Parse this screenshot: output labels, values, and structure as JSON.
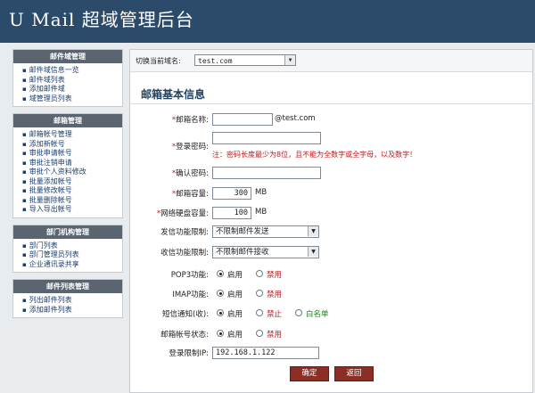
{
  "header": {
    "title": "U Mail 超域管理后台"
  },
  "sidebar": {
    "panels": [
      {
        "title": "邮件域管理",
        "items": [
          "邮件域信息一览",
          "邮件域列表",
          "添加邮件域",
          "域管理员列表"
        ]
      },
      {
        "title": "邮箱管理",
        "items": [
          "邮箱帐号管理",
          "添加新帐号",
          "审批申请帐号",
          "审批注销申请",
          "审批个人资料修改",
          "批量添加帐号",
          "批量修改帐号",
          "批量删除帐号",
          "导入导出帐号"
        ]
      },
      {
        "title": "部门机构管理",
        "items": [
          "部门列表",
          "部门管理员列表",
          "企业通讯录共享"
        ]
      },
      {
        "title": "邮件列表管理",
        "items": [
          "列出邮件列表",
          "添加邮件列表"
        ]
      }
    ]
  },
  "topbar": {
    "label": "切换当前域名:",
    "domain": "test.com"
  },
  "form": {
    "title": "邮箱基本信息",
    "mailbox_name": {
      "label": "邮箱名称:",
      "value": "",
      "suffix": "@test.com"
    },
    "password": {
      "label": "登录密码:",
      "value": "",
      "hint": "注：密码长度最少为8位，且不能为全数字或全字母，以及数字！"
    },
    "confirm": {
      "label": "确认密码:",
      "value": ""
    },
    "mail_capacity": {
      "label": "邮箱容量:",
      "value": "300",
      "unit": "MB"
    },
    "disk_capacity": {
      "label": "网络硬盘容量:",
      "value": "100",
      "unit": "MB"
    },
    "send_limit": {
      "label": "发信功能限制:",
      "value": "不限制邮件发送"
    },
    "recv_limit": {
      "label": "收信功能限制:",
      "value": "不限制邮件接收"
    },
    "pop3": {
      "label": "POP3功能:",
      "opt_on": "启用",
      "opt_off": "禁用",
      "selected": "启用"
    },
    "imap": {
      "label": "IMAP功能:",
      "opt_on": "启用",
      "opt_off": "禁用",
      "selected": "启用"
    },
    "sms": {
      "label": "短信通知(收):",
      "opt_on": "启用",
      "opt_off": "禁止",
      "opt_white": "白名单",
      "selected": "启用"
    },
    "status": {
      "label": "邮箱帐号状态:",
      "opt_on": "启用",
      "opt_off": "禁用",
      "selected": "启用"
    },
    "login_ip": {
      "label": "登录限制IP:",
      "value": "192.168.1.122"
    },
    "ok_label": "确定",
    "back_label": "返回"
  }
}
